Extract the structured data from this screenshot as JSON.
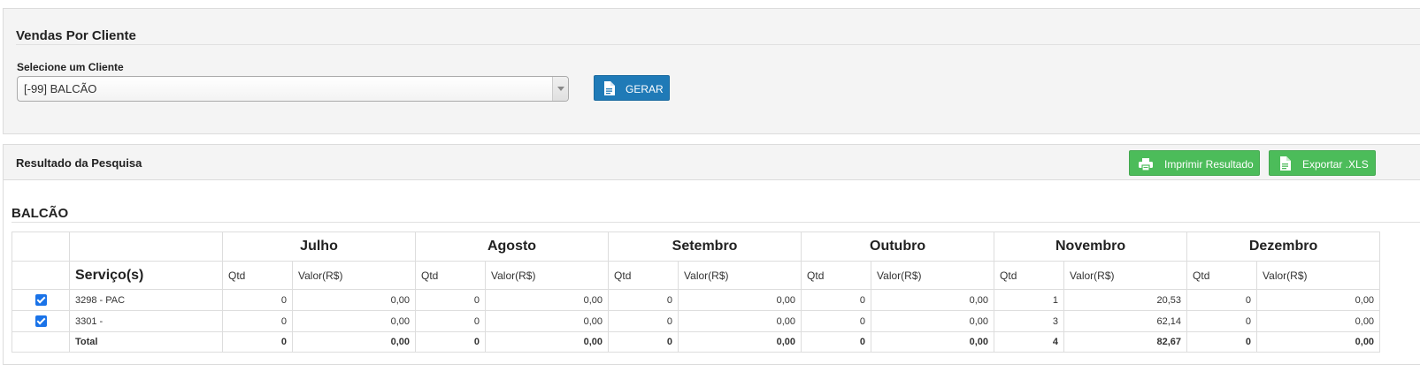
{
  "search_panel": {
    "title": "Vendas Por Cliente",
    "select_label": "Selecione um Cliente",
    "selected_client": "[-99] BALCÃO",
    "generate_button": "GERAR"
  },
  "result_panel": {
    "title": "Resultado da Pesquisa",
    "print_button": "Imprimir Resultado",
    "export_button": "Exportar .XLS",
    "client_name": "BALCÃO"
  },
  "table": {
    "months": [
      "Julho",
      "Agosto",
      "Setembro",
      "Outubro",
      "Novembro",
      "Dezembro"
    ],
    "services_header": "Serviço(s)",
    "qty_header": "Qtd",
    "value_header": "Valor(R$)",
    "rows": [
      {
        "service": "3298 - PAC",
        "checked": true,
        "values": [
          [
            "0",
            "0,00"
          ],
          [
            "0",
            "0,00"
          ],
          [
            "0",
            "0,00"
          ],
          [
            "0",
            "0,00"
          ],
          [
            "1",
            "20,53"
          ],
          [
            "0",
            "0,00"
          ]
        ]
      },
      {
        "service": "3301 -",
        "checked": true,
        "values": [
          [
            "0",
            "0,00"
          ],
          [
            "0",
            "0,00"
          ],
          [
            "0",
            "0,00"
          ],
          [
            "0",
            "0,00"
          ],
          [
            "3",
            "62,14"
          ],
          [
            "0",
            "0,00"
          ]
        ]
      }
    ],
    "total": {
      "label": "Total",
      "values": [
        [
          "0",
          "0,00"
        ],
        [
          "0",
          "0,00"
        ],
        [
          "0",
          "0,00"
        ],
        [
          "0",
          "0,00"
        ],
        [
          "4",
          "82,67"
        ],
        [
          "0",
          "0,00"
        ]
      ]
    }
  },
  "colors": {
    "primary_button": "#1f7ab7",
    "success_button": "#4cbc5a",
    "checkbox": "#1a73e8"
  }
}
